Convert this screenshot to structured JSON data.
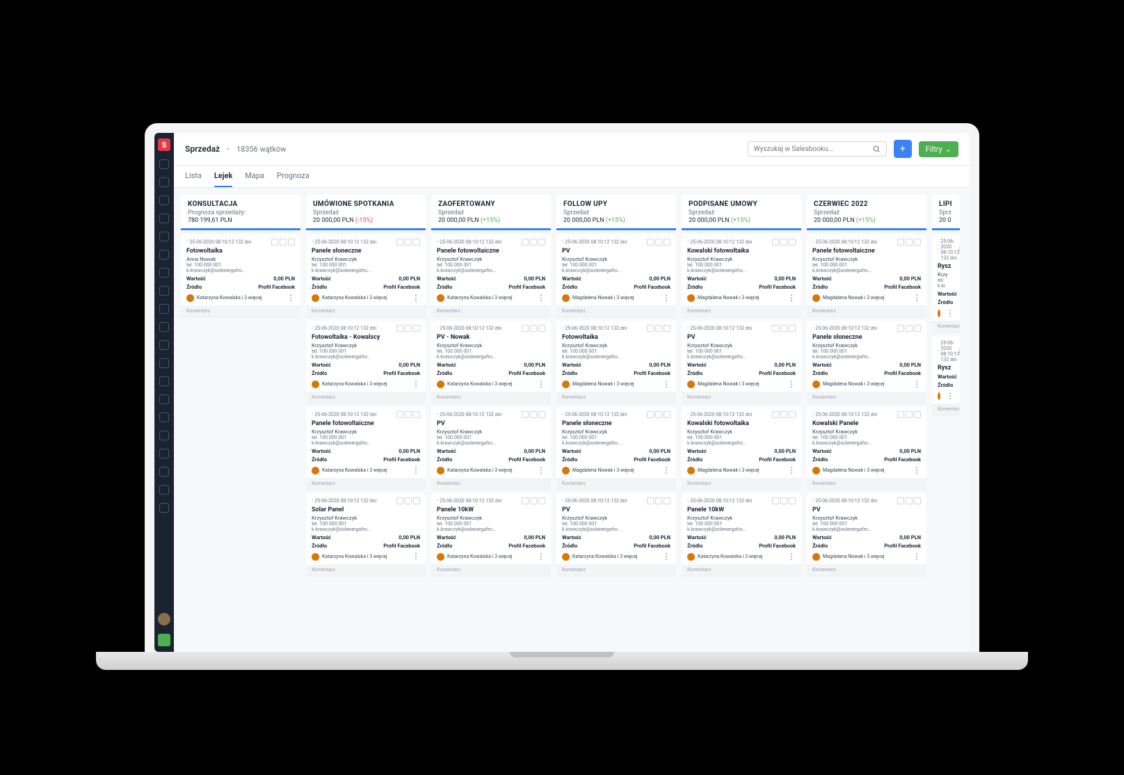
{
  "header": {
    "title": "Sprzedaż",
    "count": "18356 wątków",
    "search_placeholder": "Wyszukaj w Salesbooku...",
    "filter_label": "Filtry"
  },
  "tabs": [
    "Lista",
    "Lejek",
    "Mapa",
    "Prognoza"
  ],
  "active_tab": 1,
  "columns": [
    {
      "title": "KONSULTACJA",
      "sub": "Prognoza sprzedaży:",
      "value": "780 199,61 PLN",
      "change": "",
      "change_sign": "",
      "cards": [
        {
          "title": "Fotowoltaika",
          "contact": "Anna Nowak",
          "phone": "tel. 100 000 001",
          "email": "k.krawczyk@solenergafro...",
          "value": "0,00 PLN",
          "source": "Profil Facebook",
          "assignee": "Katarzyna Kowalska i 3 więcej"
        }
      ]
    },
    {
      "title": "UMÓWIONE SPOTKANIA",
      "sub": "Sprzedaż",
      "value": "20 000,00 PLN",
      "change": "(-15%)",
      "change_sign": "neg",
      "cards": [
        {
          "title": "Panele słoneczne",
          "contact": "Krzysztof Krawczyk",
          "phone": "tel. 100 000 001",
          "email": "k.krawczyk@solenergafro...",
          "value": "0,00 PLN",
          "source": "Profil Facebook",
          "assignee": "Katarzyna Kowalska i 3 więcej"
        },
        {
          "title": "Fotowoltaika - Kowalscy",
          "contact": "Krzysztof Krawczyk",
          "phone": "tel. 100 000 001",
          "email": "k.krawczyk@solenergafro...",
          "value": "0,00 PLN",
          "source": "Profil Facebook",
          "assignee": "Katarzyna Kowalska i 3 więcej"
        },
        {
          "title": "Panele fotowoltaiczne",
          "contact": "Krzysztof Krawczyk",
          "phone": "tel. 100 000 001",
          "email": "k.krawczyk@solenergafro...",
          "value": "0,00 PLN",
          "source": "Profil Facebook",
          "assignee": "Katarzyna Kowalska i 3 więcej"
        },
        {
          "title": "Solar Panel",
          "contact": "Krzysztof Krawczyk",
          "phone": "tel. 100 000 001",
          "email": "k.krawczyk@solenergafro...",
          "value": "0,00 PLN",
          "source": "Profil Facebook",
          "assignee": "Katarzyna Kowalska i 3 więcej"
        }
      ]
    },
    {
      "title": "ZAOFERTOWANY",
      "sub": "Sprzedaż",
      "value": "20 000,00 PLN",
      "change": "(+15%)",
      "change_sign": "pos",
      "cards": [
        {
          "title": "Panele fotowoltaiczne",
          "contact": "Krzysztof Krawczyk",
          "phone": "tel. 100 000 001",
          "email": "k.krawczyk@solenergafro...",
          "value": "0,00 PLN",
          "source": "Profil Facebook",
          "assignee": "Katarzyna Kowalska i 3 więcej"
        },
        {
          "title": "PV - Nowak",
          "contact": "Krzysztof Krawczyk",
          "phone": "tel. 100 000 001",
          "email": "k.krawczyk@solenergafro...",
          "value": "0,00 PLN",
          "source": "Profil Facebook",
          "assignee": "Katarzyna Kowalska i 3 więcej"
        },
        {
          "title": "PV",
          "contact": "Krzysztof Krawczyk",
          "phone": "tel. 100 000 001",
          "email": "k.krawczyk@solenergafro...",
          "value": "0,00 PLN",
          "source": "Profil Facebook",
          "assignee": "Katarzyna Kowalska i 3 więcej"
        },
        {
          "title": "Panele 10kW",
          "contact": "Krzysztof Krawczyk",
          "phone": "tel. 100 000 001",
          "email": "k.krawczyk@solenergafro...",
          "value": "0,00 PLN",
          "source": "Profil Facebook",
          "assignee": "Katarzyna Kowalska i 3 więcej"
        }
      ]
    },
    {
      "title": "FOLLOW UPY",
      "sub": "Sprzedaż",
      "value": "20 000,00 PLN",
      "change": "(+15%)",
      "change_sign": "pos",
      "cards": [
        {
          "title": "PV",
          "contact": "Krzysztof Krawczyk",
          "phone": "tel. 100 000 001",
          "email": "k.krawczyk@solenergafro...",
          "value": "0,00 PLN",
          "source": "Profil Facebook",
          "assignee": "Magdalena Nowak i 3 więcej"
        },
        {
          "title": "Fotowoltaika",
          "contact": "Krzysztof Krawczyk",
          "phone": "tel. 100 000 001",
          "email": "k.krawczyk@solenergafro...",
          "value": "0,00 PLN",
          "source": "Profil Facebook",
          "assignee": "Magdalena Nowak i 3 więcej"
        },
        {
          "title": "Panele słoneczne",
          "contact": "Krzysztof Krawczyk",
          "phone": "tel. 100 000 001",
          "email": "k.krawczyk@solenergafro...",
          "value": "0,00 PLN",
          "source": "Profil Facebook",
          "assignee": "Magdalena Nowak i 3 więcej"
        },
        {
          "title": "PV",
          "contact": "Krzysztof Krawczyk",
          "phone": "tel. 100 000 001",
          "email": "k.krawczyk@solenergafro...",
          "value": "0,00 PLN",
          "source": "Profil Facebook",
          "assignee": "Katarzyna Kowalska i 3 więcej"
        }
      ]
    },
    {
      "title": "PODPISANE UMOWY",
      "sub": "Sprzedaż",
      "value": "20 000,00 PLN",
      "change": "(+15%)",
      "change_sign": "pos",
      "cards": [
        {
          "title": "Kowalski fotowoltaika",
          "contact": "Krzysztof Krawczyk",
          "phone": "tel. 100 000 001",
          "email": "k.krawczyk@solenergafro...",
          "value": "0,00 PLN",
          "source": "Profil Facebook",
          "assignee": "Magdalena Nowak i 3 więcej"
        },
        {
          "title": "PV",
          "contact": "Krzysztof Krawczyk",
          "phone": "tel. 100 000 001",
          "email": "k.krawczyk@solenergafro...",
          "value": "0,00 PLN",
          "source": "Profil Facebook",
          "assignee": "Magdalena Nowak i 3 więcej"
        },
        {
          "title": "Kowalski fotowoltaika",
          "contact": "Krzysztof Krawczyk",
          "phone": "tel. 100 000 001",
          "email": "k.krawczyk@solenergafro...",
          "value": "0,00 PLN",
          "source": "Profil Facebook",
          "assignee": "Magdalena Nowak i 3 więcej"
        },
        {
          "title": "Panele 10kW",
          "contact": "Krzysztof Krawczyk",
          "phone": "tel. 100 000 001",
          "email": "k.krawczyk@solenergafro...",
          "value": "0,00 PLN",
          "source": "Profil Facebook",
          "assignee": "Katarzyna Kowalska i 3 więcej"
        }
      ]
    },
    {
      "title": "CZERWIEC 2022",
      "sub": "Sprzedaż",
      "value": "20 000,00 PLN",
      "change": "(+15%)",
      "change_sign": "pos",
      "cards": [
        {
          "title": "Panele fotowoltaiczne",
          "contact": "Krzysztof Krawczyk",
          "phone": "tel. 100 000 001",
          "email": "k.krawczyk@solenergafro...",
          "value": "0,00 PLN",
          "source": "Profil Facebook",
          "assignee": "Magdalena Nowak i 3 więcej"
        },
        {
          "title": "Panele słoneczne",
          "contact": "Krzysztof Krawczyk",
          "phone": "tel. 100 000 001",
          "email": "k.krawczyk@solenergafro...",
          "value": "0,00 PLN",
          "source": "Profil Facebook",
          "assignee": "Magdalena Nowak i 3 więcej"
        },
        {
          "title": "Kowalski Panele",
          "contact": "Krzysztof Krawczyk",
          "phone": "tel. 100 000 001",
          "email": "k.krawczyk@solenergafro...",
          "value": "0,00 PLN",
          "source": "Profil Facebook",
          "assignee": "Magdalena Nowak i 3 więcej"
        },
        {
          "title": "PV",
          "contact": "Krzysztof Krawczyk",
          "phone": "tel. 100 000 001",
          "email": "k.krawczyk@solenergafro...",
          "value": "0,00 PLN",
          "source": "Profil Facebook",
          "assignee": "Magdalena Nowak i 3 więcej"
        }
      ]
    },
    {
      "title": "LIPI",
      "sub": "Sprz",
      "value": "20 0",
      "change": "",
      "change_sign": "",
      "cards": [
        {
          "title": "Rysz",
          "contact": "Krzy",
          "phone": "tel.",
          "email": "k.kr",
          "value": "",
          "source": "",
          "assignee": ""
        },
        {
          "title": "Rysz",
          "contact": "",
          "phone": "",
          "email": "",
          "value": "",
          "source": "",
          "assignee": ""
        }
      ]
    }
  ],
  "card_meta": {
    "date": "25-06-2020  08:10:12  132 dni",
    "wartosc_label": "Wartość",
    "zrodlo_label": "Źródło",
    "comment": "Komentarz"
  },
  "nav_icons": [
    "dashboard",
    "chart",
    "monitor",
    "calendar",
    "folder",
    "document",
    "file",
    "copy",
    "users",
    "building",
    "grid",
    "car",
    "send",
    "download",
    "mail",
    "bell",
    "list",
    "user",
    "search",
    "gear"
  ]
}
